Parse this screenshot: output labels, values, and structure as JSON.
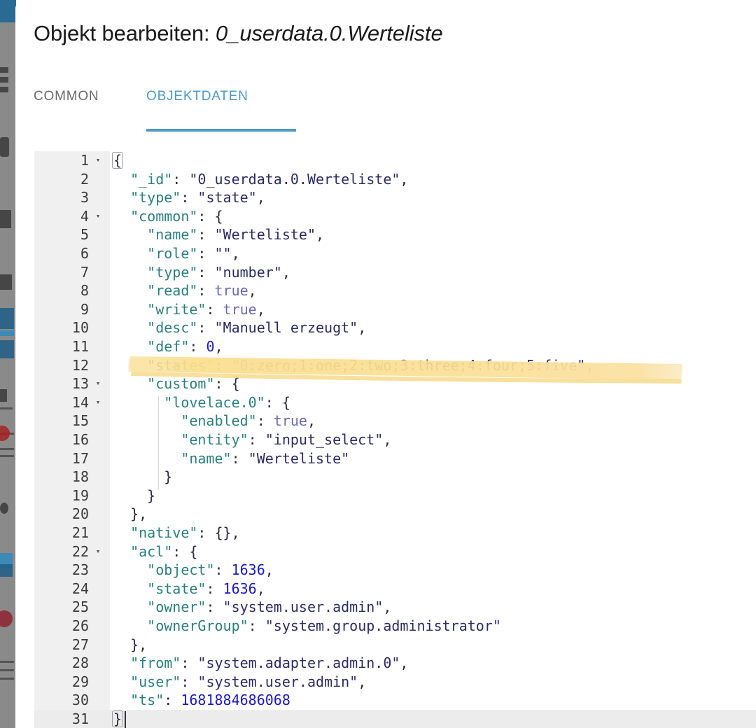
{
  "dialog": {
    "title_prefix": "Objekt bearbeiten: ",
    "title_object": "0_userdata.0.Werteliste"
  },
  "tabs": [
    {
      "id": "common",
      "label": "COMMON",
      "active": false
    },
    {
      "id": "objektdaten",
      "label": "OBJEKTDATEN",
      "active": true
    }
  ],
  "colors": {
    "accent": "#4e9ac6",
    "key": "#2a7e7e",
    "string": "#2b2b63",
    "boolean": "#6a6aae",
    "number": "#1a1ac4",
    "gutter_bg": "#f0f0f0",
    "active_line_bg": "#ececec",
    "highlight_marker": "#fae3a0"
  },
  "editor": {
    "language": "json",
    "total_lines": 31,
    "active_line": 31,
    "highlighted_line": 12,
    "lines": [
      {
        "n": 1,
        "fold": true,
        "indent": 0,
        "text": "{"
      },
      {
        "n": 2,
        "fold": false,
        "indent": 1,
        "text": "\"_id\": \"0_userdata.0.Werteliste\","
      },
      {
        "n": 3,
        "fold": false,
        "indent": 1,
        "text": "\"type\": \"state\","
      },
      {
        "n": 4,
        "fold": true,
        "indent": 1,
        "text": "\"common\": {"
      },
      {
        "n": 5,
        "fold": false,
        "indent": 2,
        "text": "\"name\": \"Werteliste\","
      },
      {
        "n": 6,
        "fold": false,
        "indent": 2,
        "text": "\"role\": \"\","
      },
      {
        "n": 7,
        "fold": false,
        "indent": 2,
        "text": "\"type\": \"number\","
      },
      {
        "n": 8,
        "fold": false,
        "indent": 2,
        "text": "\"read\": true,"
      },
      {
        "n": 9,
        "fold": false,
        "indent": 2,
        "text": "\"write\": true,"
      },
      {
        "n": 10,
        "fold": false,
        "indent": 2,
        "text": "\"desc\": \"Manuell erzeugt\","
      },
      {
        "n": 11,
        "fold": false,
        "indent": 2,
        "text": "\"def\": 0,"
      },
      {
        "n": 12,
        "fold": false,
        "indent": 2,
        "text": "\"states\": \"0:zero;1:one;2:two;3:three;4:four;5:five\","
      },
      {
        "n": 13,
        "fold": true,
        "indent": 2,
        "text": "\"custom\": {"
      },
      {
        "n": 14,
        "fold": true,
        "indent": 3,
        "text": "\"lovelace.0\": {"
      },
      {
        "n": 15,
        "fold": false,
        "indent": 4,
        "text": "\"enabled\": true,"
      },
      {
        "n": 16,
        "fold": false,
        "indent": 4,
        "text": "\"entity\": \"input_select\","
      },
      {
        "n": 17,
        "fold": false,
        "indent": 4,
        "text": "\"name\": \"Werteliste\""
      },
      {
        "n": 18,
        "fold": false,
        "indent": 3,
        "text": "}"
      },
      {
        "n": 19,
        "fold": false,
        "indent": 2,
        "text": "}"
      },
      {
        "n": 20,
        "fold": false,
        "indent": 1,
        "text": "},"
      },
      {
        "n": 21,
        "fold": false,
        "indent": 1,
        "text": "\"native\": {},"
      },
      {
        "n": 22,
        "fold": true,
        "indent": 1,
        "text": "\"acl\": {"
      },
      {
        "n": 23,
        "fold": false,
        "indent": 2,
        "text": "\"object\": 1636,"
      },
      {
        "n": 24,
        "fold": false,
        "indent": 2,
        "text": "\"state\": 1636,"
      },
      {
        "n": 25,
        "fold": false,
        "indent": 2,
        "text": "\"owner\": \"system.user.admin\","
      },
      {
        "n": 26,
        "fold": false,
        "indent": 2,
        "text": "\"ownerGroup\": \"system.group.administrator\""
      },
      {
        "n": 27,
        "fold": false,
        "indent": 1,
        "text": "},"
      },
      {
        "n": 28,
        "fold": false,
        "indent": 1,
        "text": "\"from\": \"system.adapter.admin.0\","
      },
      {
        "n": 29,
        "fold": false,
        "indent": 1,
        "text": "\"user\": \"system.user.admin\","
      },
      {
        "n": 30,
        "fold": false,
        "indent": 1,
        "text": "\"ts\": 1681884686068"
      },
      {
        "n": 31,
        "fold": false,
        "indent": 0,
        "text": "}"
      }
    ]
  },
  "annotation": {
    "type": "highlighter-stroke",
    "color": "#fae3a0",
    "target_line": 12,
    "target_text": "\"states\": \"0:zero;1:one;2:two;3:three;4:four;5:five\","
  }
}
